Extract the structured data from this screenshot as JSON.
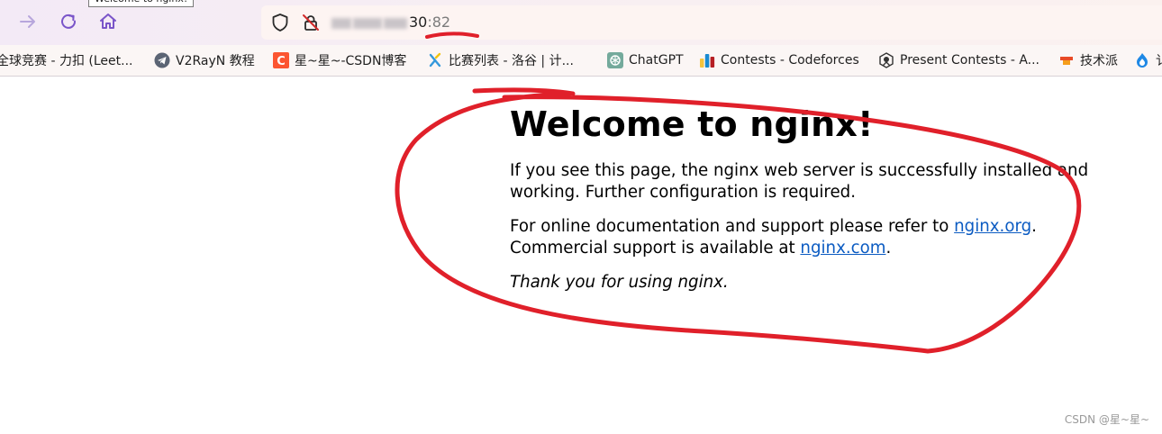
{
  "tab": {
    "title": "Welcome to nginx!"
  },
  "toolbar": {
    "forward_icon": "forward-arrow-icon",
    "reload_icon": "reload-icon",
    "home_icon": "home-icon"
  },
  "address": {
    "visible_text": "30",
    "port": ":82"
  },
  "bookmarks": [
    {
      "label": "全球竞赛 - 力扣 (Leet...",
      "icon": "leetcode-icon"
    },
    {
      "label": "V2RayN 教程",
      "icon": "telegram-icon"
    },
    {
      "label": "星~星~-CSDN博客",
      "icon": "csdn-icon"
    },
    {
      "label": "比赛列表 - 洛谷 | 计...",
      "icon": "luogu-icon"
    },
    {
      "label": "ChatGPT",
      "icon": "chatgpt-icon"
    },
    {
      "label": "Contests - Codeforces",
      "icon": "codeforces-icon"
    },
    {
      "label": "Present Contests - A...",
      "icon": "atcoder-icon"
    },
    {
      "label": "技术派",
      "icon": "jishupai-icon"
    },
    {
      "label": "讠",
      "icon": "blue-flame-icon"
    }
  ],
  "page": {
    "heading": "Welcome to nginx!",
    "para1": "If you see this page, the nginx web server is successfully installed and working. Further configuration is required.",
    "para2_prefix": "For online documentation and support please refer to ",
    "link1": "nginx.org",
    "para2_mid": ".",
    "para2_line2": "Commercial support is available at ",
    "link2": "nginx.com",
    "para2_end": ".",
    "para3": "Thank you for using nginx."
  },
  "watermark": "CSDN @星~星~",
  "colors": {
    "annotation": "#e0202a",
    "link": "#0b5bc2",
    "toolbar_icon": "#7a55c9"
  }
}
